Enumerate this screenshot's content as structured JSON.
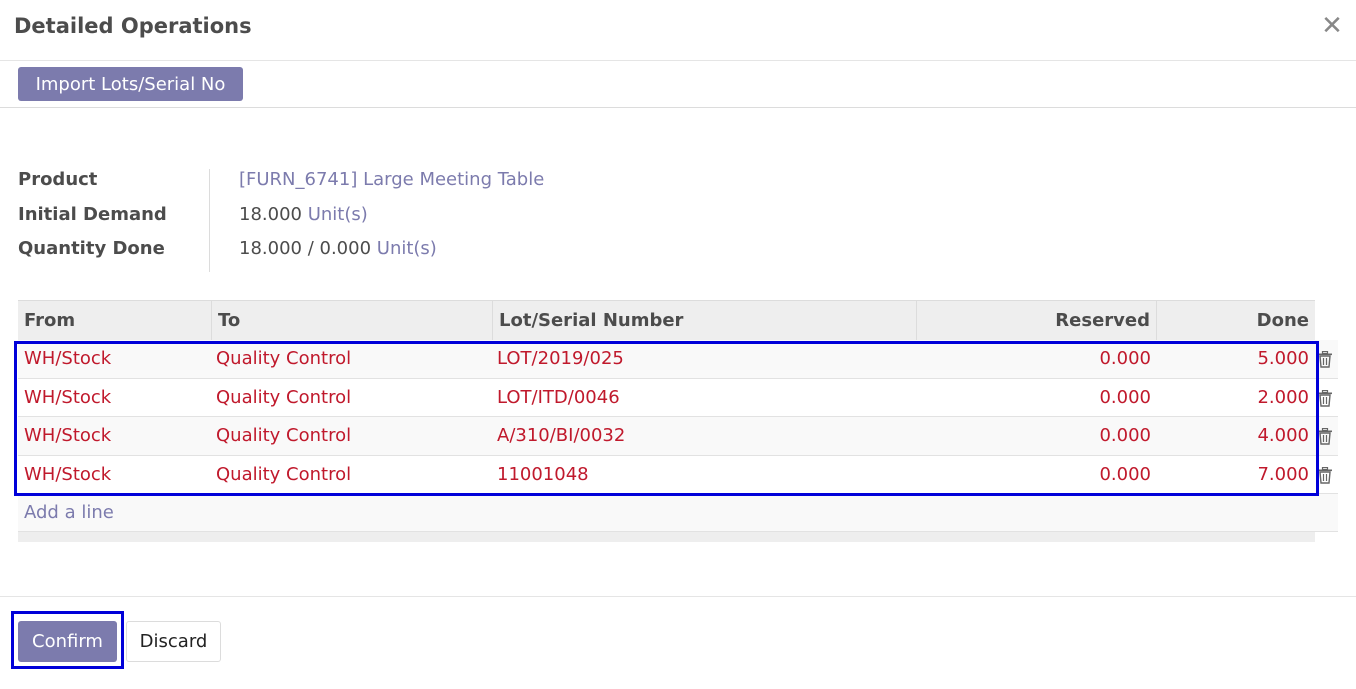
{
  "dialog": {
    "title": "Detailed Operations"
  },
  "toolbar": {
    "import_label": "Import Lots/Serial No"
  },
  "info": {
    "product_label": "Product",
    "product_value": "[FURN_6741] Large Meeting Table",
    "demand_label": "Initial Demand",
    "demand_qty": "18.000",
    "demand_uom": "Unit(s)",
    "done_label": "Quantity Done",
    "done_qty": "18.000 / 0.000",
    "done_uom": "Unit(s)"
  },
  "table": {
    "headers": {
      "from": "From",
      "to": "To",
      "lot": "Lot/Serial Number",
      "reserved": "Reserved",
      "done": "Done"
    },
    "rows": [
      {
        "from": "WH/Stock",
        "to": "Quality Control",
        "lot": "LOT/2019/025",
        "reserved": "0.000",
        "done": "5.000"
      },
      {
        "from": "WH/Stock",
        "to": "Quality Control",
        "lot": "LOT/ITD/0046",
        "reserved": "0.000",
        "done": "2.000"
      },
      {
        "from": "WH/Stock",
        "to": "Quality Control",
        "lot": "A/310/BI/0032",
        "reserved": "0.000",
        "done": "4.000"
      },
      {
        "from": "WH/Stock",
        "to": "Quality Control",
        "lot": "11001048",
        "reserved": "0.000",
        "done": "7.000"
      }
    ],
    "add_line": "Add a line"
  },
  "footer": {
    "confirm_label": "Confirm",
    "discard_label": "Discard"
  },
  "colors": {
    "accent": "#7c7bad",
    "row_text": "#c0192c",
    "highlight": "#0000d9"
  }
}
